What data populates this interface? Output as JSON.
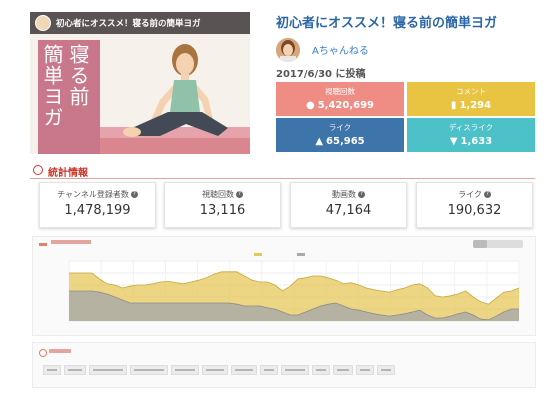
{
  "thumbnail": {
    "bar_title": "初心者にオススメ！寝る前の簡単ヨガ",
    "overlay_col1": "簡単ヨガ",
    "overlay_col2": "寝る前"
  },
  "video": {
    "title": "初心者にオススメ！寝る前の簡単ヨガ",
    "channel_name": "Aちゃんねる",
    "posted_date": "2017/6/30 に投稿"
  },
  "metrics": [
    {
      "label": "視聴回数",
      "value": "5,420,699",
      "icon": "user-icon",
      "color": "#ef8c84"
    },
    {
      "label": "コメント",
      "value": "1,294",
      "icon": "comment-icon",
      "color": "#e8c442"
    },
    {
      "label": "ライク",
      "value": "65,965",
      "icon": "thumbs-up-icon",
      "color": "#3d74a9"
    },
    {
      "label": "ディスライク",
      "value": "1,633",
      "icon": "thumbs-down-icon",
      "color": "#4cc1c8"
    }
  ],
  "stats": {
    "title": "統計情報",
    "cards": [
      {
        "label": "チャンネル登録者数",
        "value": "1,478,199"
      },
      {
        "label": "視聴回数",
        "value": "13,116"
      },
      {
        "label": "動画数",
        "value": "47,164"
      },
      {
        "label": "ライク",
        "value": "190,632"
      }
    ]
  },
  "chart_data": {
    "type": "area",
    "title": "",
    "xlabel": "",
    "ylabel": "",
    "grid": true,
    "legend": "top-center",
    "series": [
      {
        "color": "#e6c75a",
        "values": [
          80,
          80,
          80,
          80,
          70,
          62,
          60,
          55,
          58,
          60,
          60,
          62,
          65,
          66,
          64,
          62,
          65,
          68,
          72,
          78,
          82,
          82,
          82,
          75,
          68,
          65,
          65,
          60,
          50,
          58,
          70,
          72,
          75,
          75,
          72,
          68,
          62,
          64,
          60,
          55,
          52,
          50,
          48,
          52,
          55,
          60,
          62,
          55,
          42,
          40,
          42,
          45,
          50,
          40,
          32,
          28,
          38,
          48,
          50,
          55
        ]
      },
      {
        "color": "#a9a9a9",
        "values": [
          50,
          50,
          50,
          50,
          48,
          45,
          40,
          35,
          30,
          30,
          30,
          30,
          30,
          30,
          30,
          30,
          30,
          30,
          30,
          30,
          30,
          30,
          28,
          25,
          25,
          25,
          22,
          20,
          15,
          10,
          10,
          15,
          20,
          25,
          28,
          30,
          25,
          20,
          18,
          15,
          12,
          10,
          8,
          10,
          12,
          15,
          18,
          10,
          5,
          5,
          8,
          12,
          15,
          10,
          3,
          2,
          8,
          15,
          20,
          20
        ]
      }
    ]
  },
  "colors": {
    "title_blue": "#2b66a6",
    "stats_red": "#c9362c"
  }
}
